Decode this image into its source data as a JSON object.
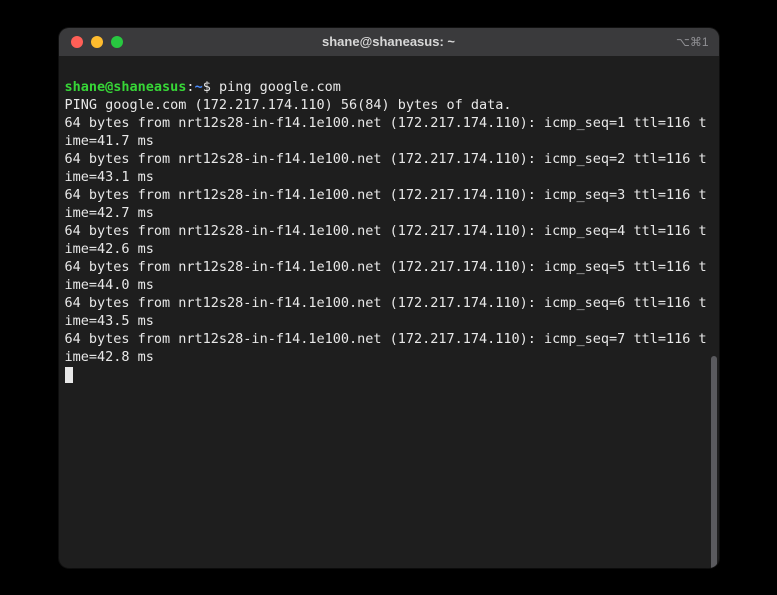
{
  "titlebar": {
    "title": "shane@shaneasus: ~",
    "shortcut": "⌥⌘1"
  },
  "prompt": {
    "user_host": "shane@shaneasus",
    "separator": ":",
    "path": "~",
    "dollar": "$"
  },
  "command": "ping google.com",
  "output": {
    "header": "PING google.com (172.217.174.110) 56(84) bytes of data.",
    "lines": [
      "64 bytes from nrt12s28-in-f14.1e100.net (172.217.174.110): icmp_seq=1 ttl=116 time=41.7 ms",
      "64 bytes from nrt12s28-in-f14.1e100.net (172.217.174.110): icmp_seq=2 ttl=116 time=43.1 ms",
      "64 bytes from nrt12s28-in-f14.1e100.net (172.217.174.110): icmp_seq=3 ttl=116 time=42.7 ms",
      "64 bytes from nrt12s28-in-f14.1e100.net (172.217.174.110): icmp_seq=4 ttl=116 time=42.6 ms",
      "64 bytes from nrt12s28-in-f14.1e100.net (172.217.174.110): icmp_seq=5 ttl=116 time=44.0 ms",
      "64 bytes from nrt12s28-in-f14.1e100.net (172.217.174.110): icmp_seq=6 ttl=116 time=43.5 ms",
      "64 bytes from nrt12s28-in-f14.1e100.net (172.217.174.110): icmp_seq=7 ttl=116 time=42.8 ms"
    ]
  }
}
